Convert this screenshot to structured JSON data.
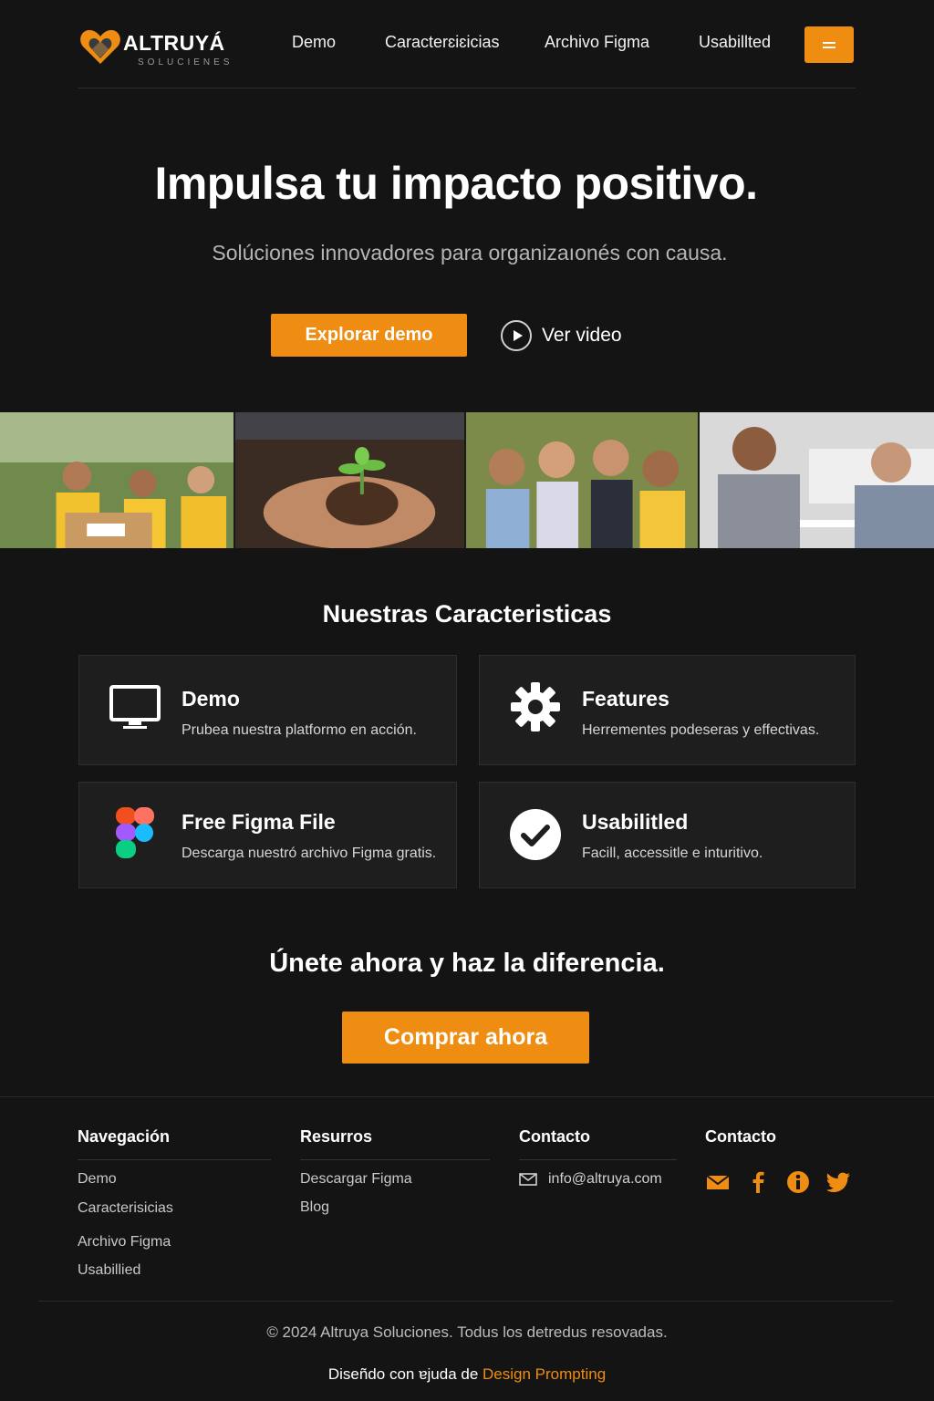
{
  "brand": {
    "name": "ALTRUYÁ",
    "tagline": "SOLUCIENES",
    "accent_color": "#ee8d12"
  },
  "nav": {
    "items": [
      "Demo",
      "Caracterɛiɛicias",
      "Archivo Figma",
      "Usabillted"
    ],
    "menu_icon": "hamburger-icon"
  },
  "hero": {
    "title": "Impulsa tu impacto positivo.",
    "subtitle": "Solúciones innovadores para organizaıonés con causa.",
    "primary_button": "Explorar demo",
    "video_label": "Ver video"
  },
  "gallery": {
    "images": [
      "volunteers-photo",
      "plant-hands-photo",
      "children-photo",
      "meeting-photo"
    ]
  },
  "features": {
    "title": "Nuestras Caracteristicas",
    "cards": [
      {
        "title": "Demo",
        "desc": "Prubea nuestra platformo en acción.",
        "icon": "monitor-icon"
      },
      {
        "title": "Features",
        "desc": "Herrementes podeseras y effectivas.",
        "icon": "gear-icon"
      },
      {
        "title": "Free Figma File",
        "desc": "Descarga nuestró archivo Figma gratis.",
        "icon": "figma-icon"
      },
      {
        "title": "Usabilitled",
        "desc": "Facill, accessitle e inturitivo.",
        "icon": "check-circle-icon"
      }
    ]
  },
  "cta": {
    "title": "Únete ahora y haz la diferencia.",
    "button": "Comprar ahora"
  },
  "footer": {
    "columns": [
      {
        "heading": "Navegación",
        "links": [
          "Demo",
          "Caracterisicias",
          "Archivo Figma",
          "Usabillied"
        ]
      },
      {
        "heading": "Resurros",
        "links": [
          "Descargar Figma",
          "Blog"
        ]
      },
      {
        "heading": "Contacto",
        "email": "info@altruya.com"
      },
      {
        "heading": "Contacto",
        "social": [
          "mail-icon",
          "facebook-icon",
          "info-icon",
          "twitter-icon"
        ]
      }
    ],
    "copyright": "© 2024 Altruya Soluciones. Todus los detredus resovadas.",
    "credit_prefix": "Diseñdo con ɐjuda de ",
    "credit_link": "Design Prompting"
  }
}
